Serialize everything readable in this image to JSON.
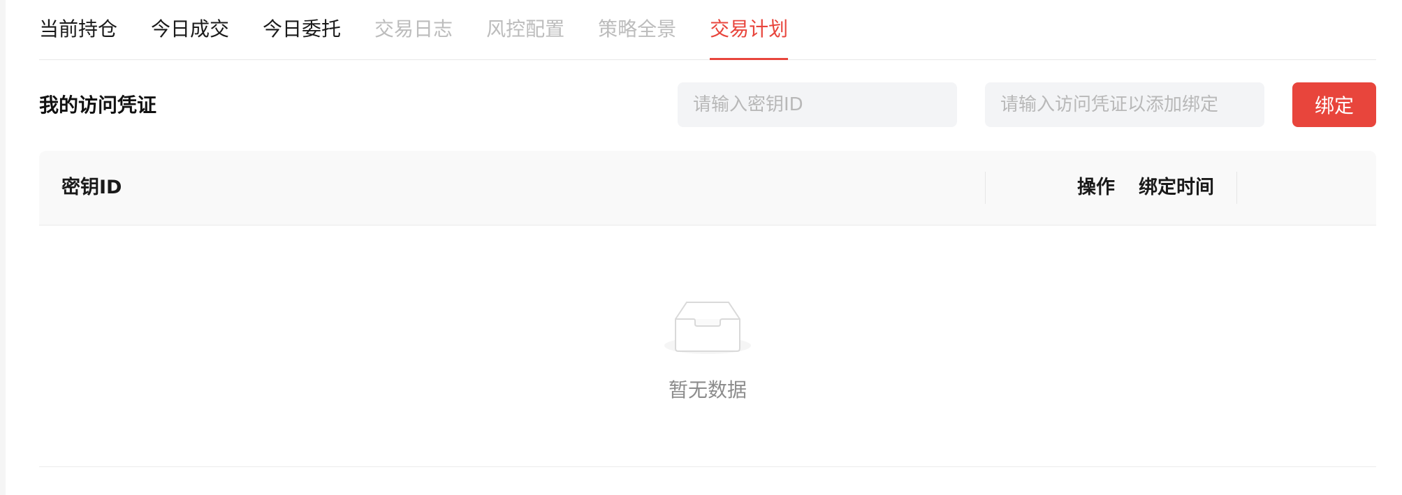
{
  "tabs": [
    {
      "label": "当前持仓",
      "state": "normal"
    },
    {
      "label": "今日成交",
      "state": "normal"
    },
    {
      "label": "今日委托",
      "state": "normal"
    },
    {
      "label": "交易日志",
      "state": "disabled"
    },
    {
      "label": "风控配置",
      "state": "disabled"
    },
    {
      "label": "策略全景",
      "state": "disabled"
    },
    {
      "label": "交易计划",
      "state": "active"
    }
  ],
  "section": {
    "title": "我的访问凭证"
  },
  "toolbar": {
    "key_placeholder": "请输入密钥ID",
    "credential_placeholder": "请输入访问凭证以添加绑定",
    "bind_label": "绑定"
  },
  "table": {
    "columns": {
      "key_id": "密钥ID",
      "bind_time": "绑定时间",
      "action": "操作"
    },
    "rows": [],
    "empty_text": "暂无数据",
    "empty_icon": "empty-inbox-icon"
  },
  "colors": {
    "accent": "#e8453c",
    "disabled_text": "#bcbcbc",
    "input_bg": "#f3f4f6",
    "header_bg": "#f9f9f9"
  }
}
